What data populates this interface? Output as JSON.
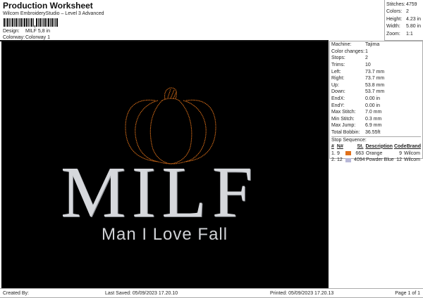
{
  "header": {
    "title": "Production Worksheet",
    "subtitle": "Wilcom EmbroideryStudio – Level 3 Advanced",
    "design_label": "Design:",
    "design_value": "MILF 5,8 in",
    "colorway_label": "Colorway:",
    "colorway_value": "Colorway 1"
  },
  "summary": [
    {
      "k": "Stitches:",
      "v": "4759"
    },
    {
      "k": "Colors:",
      "v": "2"
    },
    {
      "k": "Height:",
      "v": "4.23 in"
    },
    {
      "k": "Width:",
      "v": "5.80 in"
    },
    {
      "k": "Zoom:",
      "v": "1:1"
    }
  ],
  "details": [
    {
      "k": "Machine:",
      "v": "Tajima"
    },
    {
      "k": "Color changes:",
      "v": "1"
    },
    {
      "k": "Stops:",
      "v": "2"
    },
    {
      "k": "Trims:",
      "v": "10"
    },
    {
      "k": "Left:",
      "v": "73.7 mm"
    },
    {
      "k": "Right:",
      "v": "73.7 mm"
    },
    {
      "k": "Up:",
      "v": "53.8 mm"
    },
    {
      "k": "Down:",
      "v": "53.7 mm"
    },
    {
      "k": "EndX:",
      "v": "0.00 in"
    },
    {
      "k": "EndY:",
      "v": "0.00 in"
    },
    {
      "k": "Max Stitch:",
      "v": "7.0 mm"
    },
    {
      "k": "Min Stitch:",
      "v": "0.3 mm"
    },
    {
      "k": "Max Jump:",
      "v": "6.9 mm"
    },
    {
      "k": "Total Bobbin:",
      "v": "36.55ft"
    }
  ],
  "stop_sequence": {
    "title": "Stop Sequence:",
    "headers": [
      "#",
      "N#",
      "St.",
      "Description",
      "Code",
      "Brand"
    ],
    "rows": [
      {
        "n": "1.",
        "needle": "9",
        "color": "#e0701a",
        "st": "663",
        "desc": "Orange",
        "code": "9",
        "brand": "Wilcom"
      },
      {
        "n": "2.",
        "needle": "12",
        "color": "#b8b8d8",
        "st": "4094",
        "desc": "Powder Blue",
        "code": "12",
        "brand": "Wilcom"
      }
    ]
  },
  "design": {
    "main_text": "MILF",
    "tagline": "Man I Love Fall",
    "background": "#000000",
    "thread_orange": "#e0701a"
  },
  "footer": {
    "created": "Created By:",
    "saved": "Last Saved: 05/09/2023 17.20.10",
    "printed": "Printed: 05/09/2023 17.20.13",
    "page": "Page 1 of 1"
  }
}
